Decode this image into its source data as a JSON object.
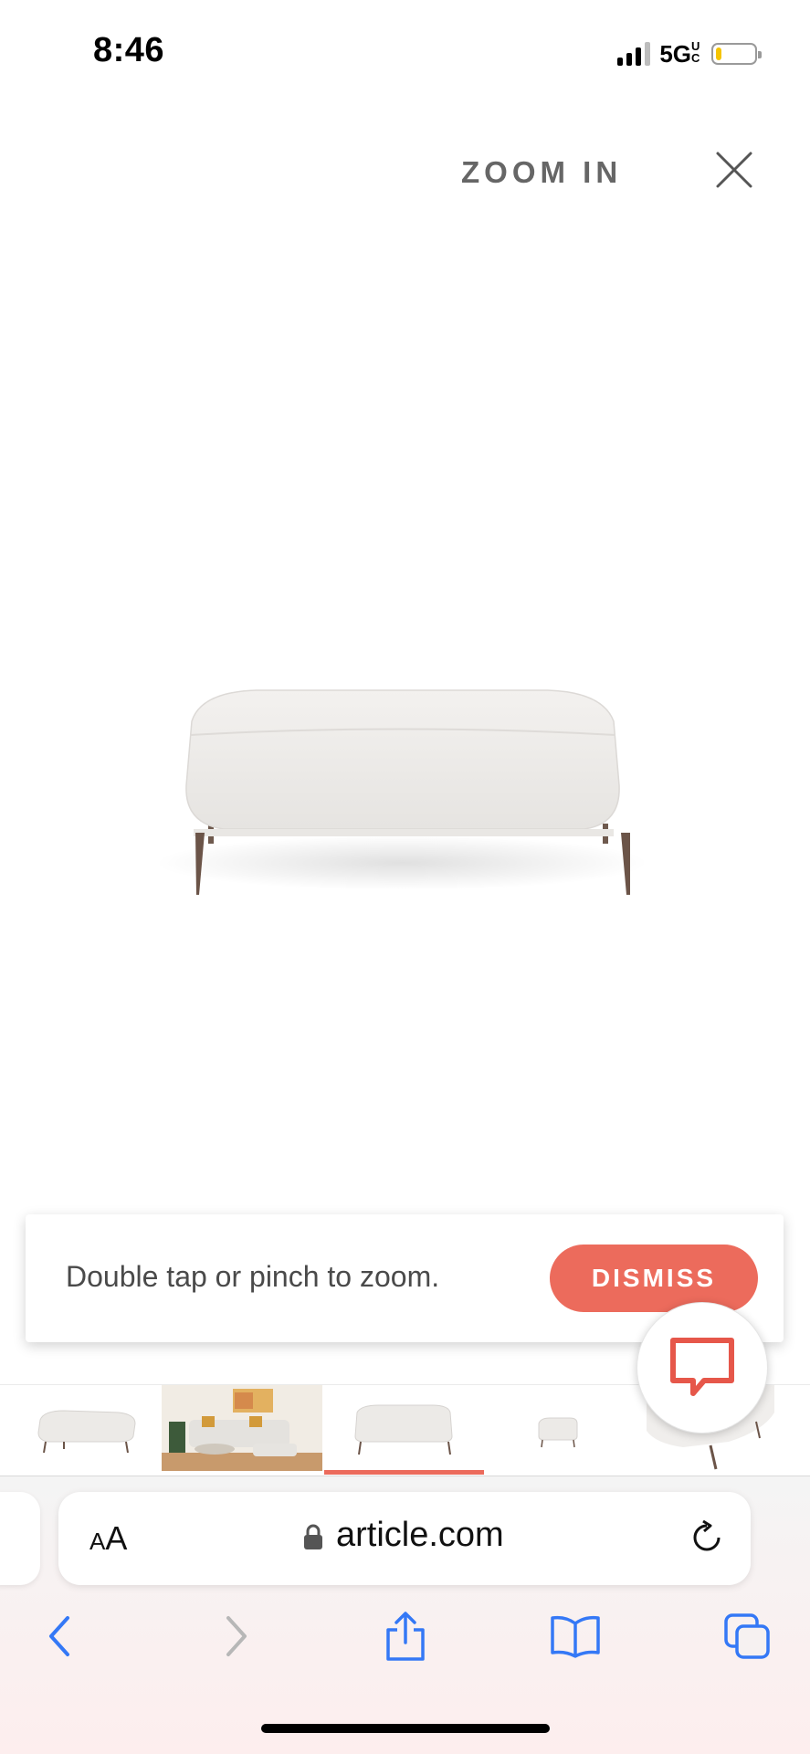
{
  "status_bar": {
    "time": "8:46",
    "network": "5G",
    "network_suffix": "UC",
    "battery_level": 0.15
  },
  "viewer": {
    "zoom_label": "ZOOM IN",
    "close_icon": "close-icon",
    "product_image": "white-ottoman-bench"
  },
  "hint": {
    "text": "Double tap or pinch to zoom.",
    "dismiss_label": "DISMISS"
  },
  "chat": {
    "icon": "chat-bubble-icon"
  },
  "thumbnails": {
    "items": [
      {
        "name": "ottoman-side-view"
      },
      {
        "name": "living-room-scene"
      },
      {
        "name": "ottoman-front-view",
        "active": true
      },
      {
        "name": "ottoman-small-view"
      },
      {
        "name": "ottoman-corner-detail"
      }
    ]
  },
  "browser": {
    "text_size_label_small": "A",
    "text_size_label_large": "A",
    "domain": "article.com"
  },
  "colors": {
    "accent": "#ec6b5c",
    "safari_blue": "#3478f6"
  }
}
